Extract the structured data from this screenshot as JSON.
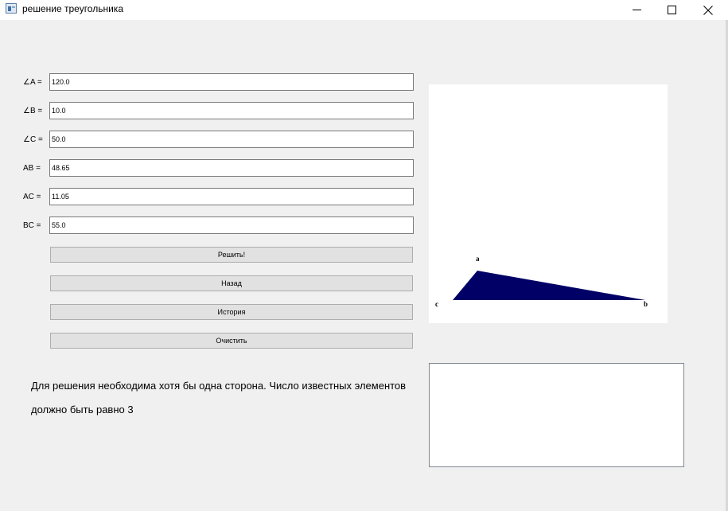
{
  "window": {
    "title": "решение треугольника",
    "icon": "app-window-icon",
    "controls": [
      "minimize-icon",
      "maximize-icon",
      "close-icon"
    ]
  },
  "fields": [
    {
      "label": "∠A =",
      "value": "120.0"
    },
    {
      "label": "∠B =",
      "value": "10.0"
    },
    {
      "label": "∠C =",
      "value": "50.0"
    },
    {
      "label": "AB =",
      "value": "48.65"
    },
    {
      "label": "AC =",
      "value": "11.05"
    },
    {
      "label": "BC =",
      "value": "55.0"
    }
  ],
  "buttons": {
    "solve": "Решить!",
    "back": "Назад",
    "history": "История",
    "clear": "Очистить"
  },
  "message": "Для решения необходима хотя бы одна сторона. Число известных элементов должно быть равно 3",
  "triangle": {
    "fill_color": "#000066",
    "vertex_labels": {
      "a": "a",
      "b": "b",
      "c": "c"
    }
  },
  "output": {
    "text": ""
  }
}
